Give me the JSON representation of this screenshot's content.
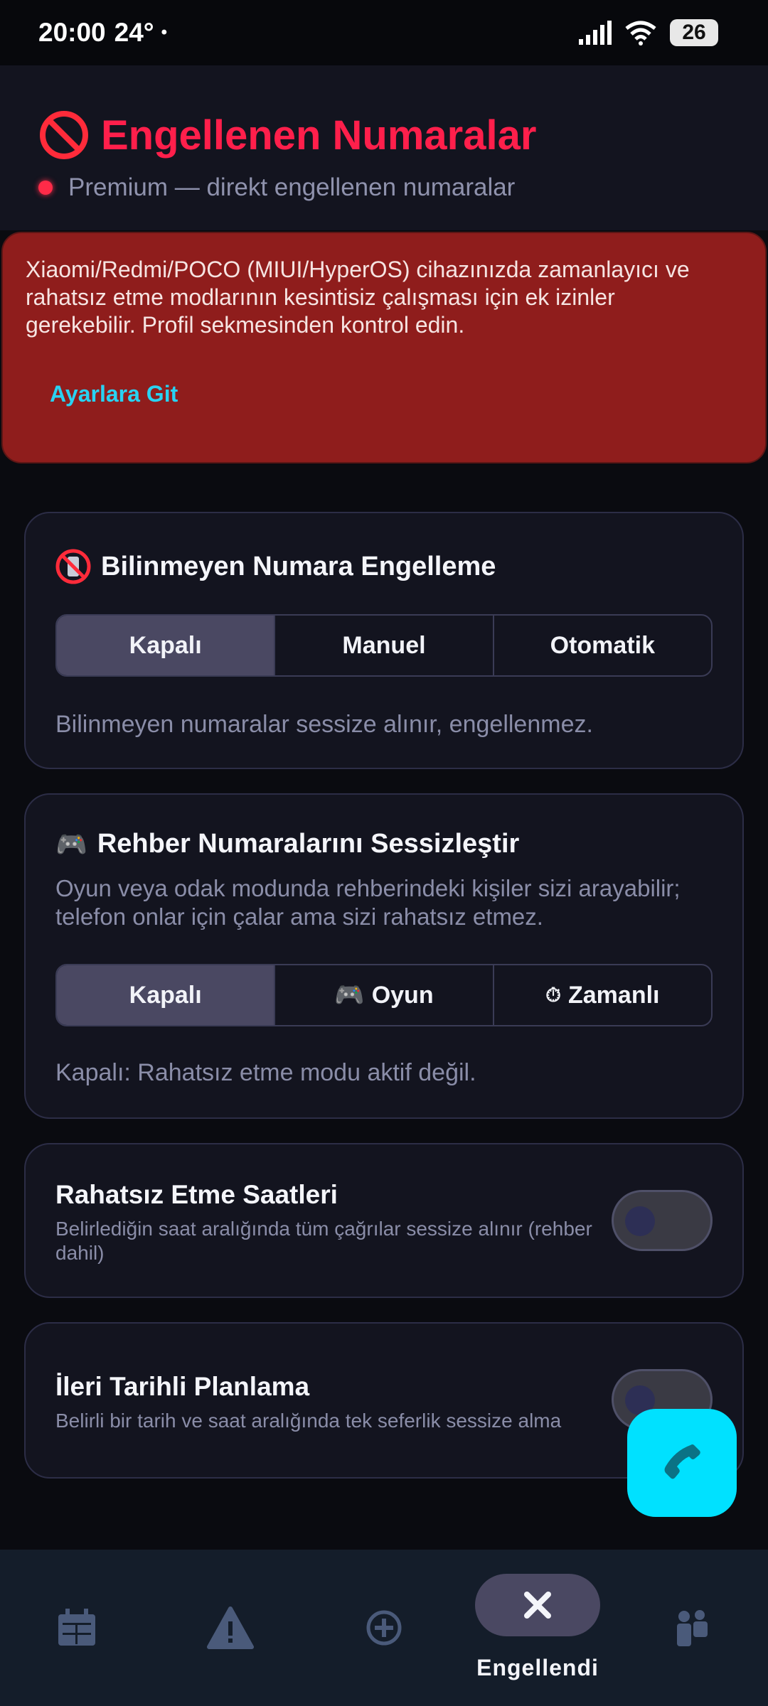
{
  "status_bar": {
    "time": "20:00",
    "temperature": "24°",
    "dot": "•",
    "battery": "26"
  },
  "header": {
    "title": "Engellenen Numaralar",
    "subtitle": "Premium — direkt engellenen numaralar"
  },
  "warning": {
    "text": "Xiaomi/Redmi/POCO (MIUI/HyperOS) cihazınızda zamanlayıcı ve rahatsız etme modlarının kesintisiz çalışması için ek izinler gerekebilir. Profil sekmesinden kontrol edin.",
    "link": "Ayarlara Git"
  },
  "unknown_block": {
    "title": "Bilinmeyen Numara Engelleme",
    "options": [
      "Kapalı",
      "Manuel",
      "Otomatik"
    ],
    "selected": "Kapalı",
    "note": "Bilinmeyen numaralar sessize alınır, engellenmez."
  },
  "contacts_silence": {
    "title": "Rehber Numaralarını Sessizleştir",
    "description": "Oyun veya odak modunda rehberindeki kişiler sizi arayabilir; telefon onlar için çalar ama sizi rahatsız etmez.",
    "options": [
      "Kapalı",
      "Oyun",
      "Zamanlı"
    ],
    "option_icons": [
      "",
      "🎮",
      "⏱"
    ],
    "selected": "Kapalı",
    "note": "Kapalı: Rahatsız etme modu aktif değil."
  },
  "dnd_hours": {
    "title": "Rahatsız Etme Saatleri",
    "subtitle": "Belirlediğin saat aralığında tüm çağrılar sessize alınır (rehber dahil)",
    "enabled": false
  },
  "future_planning": {
    "title": "İleri Tarihli Planlama",
    "subtitle": "Belirli bir tarih ve saat aralığında tek seferlik sessize alma",
    "enabled": false
  },
  "bottom_nav": {
    "items": [
      {
        "icon": "calendar-icon",
        "label": ""
      },
      {
        "icon": "warning-icon",
        "label": ""
      },
      {
        "icon": "add-circle-icon",
        "label": ""
      },
      {
        "icon": "close-icon",
        "label": "Engellendi",
        "active": true
      },
      {
        "icon": "people-icon",
        "label": ""
      }
    ]
  },
  "colors": {
    "accent_red": "#ff1f4b",
    "warning_bg": "#8f1d1c",
    "link_cyan": "#29d2f2",
    "fab": "#00e1ff"
  }
}
